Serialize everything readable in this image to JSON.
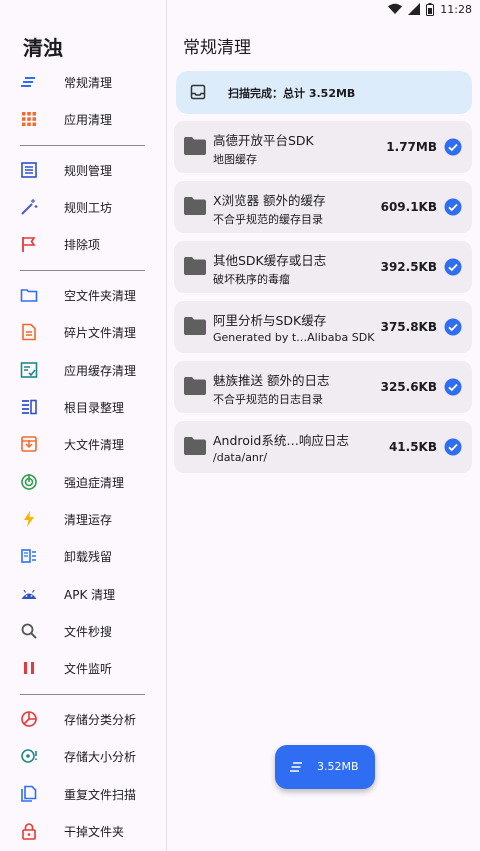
{
  "status": {
    "time": "11:28"
  },
  "drawer": {
    "title": "清浊",
    "items": [
      {
        "label": "常规清理",
        "icon": "broom-lines-icon",
        "color": "#2f6ef2"
      },
      {
        "label": "应用清理",
        "icon": "apps-grid-icon",
        "color": "#f06a2c"
      },
      {
        "label": "规则管理",
        "icon": "list-box-icon",
        "color": "#3152c8"
      },
      {
        "label": "规则工坊",
        "icon": "magic-wand-icon",
        "color": "#4b5bd4"
      },
      {
        "label": "排除项",
        "icon": "flag-icon",
        "color": "#e53935"
      },
      {
        "label": "空文件夹清理",
        "icon": "folder-outline-icon",
        "color": "#2f6ef2"
      },
      {
        "label": "碎片文件清理",
        "icon": "document-icon",
        "color": "#f06a2c"
      },
      {
        "label": "应用缓存清理",
        "icon": "cache-check-icon",
        "color": "#1f8a85"
      },
      {
        "label": "根目录整理",
        "icon": "columns-icon",
        "color": "#3152c8"
      },
      {
        "label": "大文件清理",
        "icon": "big-file-icon",
        "color": "#f06a2c"
      },
      {
        "label": "强迫症清理",
        "icon": "target-icon",
        "color": "#2e9e4f"
      },
      {
        "label": "清理运存",
        "icon": "lightning-icon",
        "color": "#f5b400"
      },
      {
        "label": "卸载残留",
        "icon": "uninstall-icon",
        "color": "#2f6ef2"
      },
      {
        "label": "APK 清理",
        "icon": "android-icon",
        "color": "#3152c8"
      },
      {
        "label": "文件秒搜",
        "icon": "search-icon",
        "color": "#555555"
      },
      {
        "label": "文件监听",
        "icon": "pause-icon",
        "color": "#e53935"
      },
      {
        "label": "存储分类分析",
        "icon": "pie-chart-icon",
        "color": "#e53935"
      },
      {
        "label": "存储大小分析",
        "icon": "storage-size-icon",
        "color": "#1f8a85"
      },
      {
        "label": "重复文件扫描",
        "icon": "duplicate-file-icon",
        "color": "#2f6ef2"
      },
      {
        "label": "干掉文件夹",
        "icon": "lock-icon",
        "color": "#e53935"
      }
    ]
  },
  "main": {
    "title": "常规清理",
    "summary": "扫描完成：总计 3.52MB",
    "rows": [
      {
        "name": "高德开放平台SDK",
        "sub": "地图缓存",
        "size": "1.77MB"
      },
      {
        "name": "X浏览器 额外的缓存",
        "sub": "不合乎规范的缓存目录",
        "size": "609.1KB"
      },
      {
        "name": "其他SDK缓存或日志",
        "sub": "破坏秩序的毒瘤",
        "size": "392.5KB"
      },
      {
        "name": "阿里分析与SDK缓存",
        "sub": "Generated by t…Alibaba SDK",
        "size": "375.8KB"
      },
      {
        "name": "魅族推送 额外的日志",
        "sub": "不合乎规范的日志目录",
        "size": "325.6KB"
      },
      {
        "name": "Android系统…响应日志",
        "sub": "/data/anr/",
        "size": "41.5KB"
      }
    ],
    "fab_label": "3.52MB"
  },
  "colors": {
    "accent": "#2f6ef2",
    "summary_bg": "#dcecfa",
    "row_bg": "#f1ecf1"
  }
}
